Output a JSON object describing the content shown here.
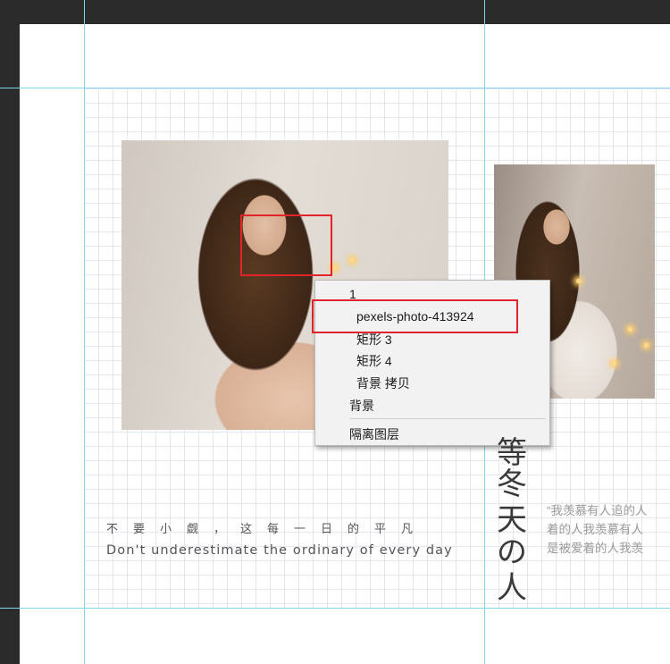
{
  "context_menu": {
    "items": [
      {
        "label": "1",
        "indent": 0
      },
      {
        "label": "pexels-photo-413924",
        "indent": 1
      },
      {
        "label": "矩形 3",
        "indent": 1
      },
      {
        "label": "矩形 4",
        "indent": 1
      },
      {
        "label": "背景 拷贝",
        "indent": 1
      },
      {
        "label": "背景",
        "indent": 0
      },
      {
        "label": "隔离图层",
        "indent": 0
      }
    ]
  },
  "poster": {
    "cn_chars": [
      "不",
      "要",
      "小",
      "觑",
      "，",
      "这",
      "每",
      "一",
      "日",
      "的",
      "平",
      "凡"
    ],
    "en_line": "Don't underestimate the ordinary of every day",
    "vertical_chars": [
      "等",
      "冬",
      "天",
      "の",
      "人"
    ],
    "quote_lines": [
      "“我羡慕有人追的人",
      "着的人我羡慕有人",
      "是被爱着的人我羡"
    ]
  },
  "colors": {
    "highlight": "#e0242a",
    "guide": "#7fd8ea",
    "grid": "#e6e6ee",
    "workspace": "#2b2b2b"
  }
}
